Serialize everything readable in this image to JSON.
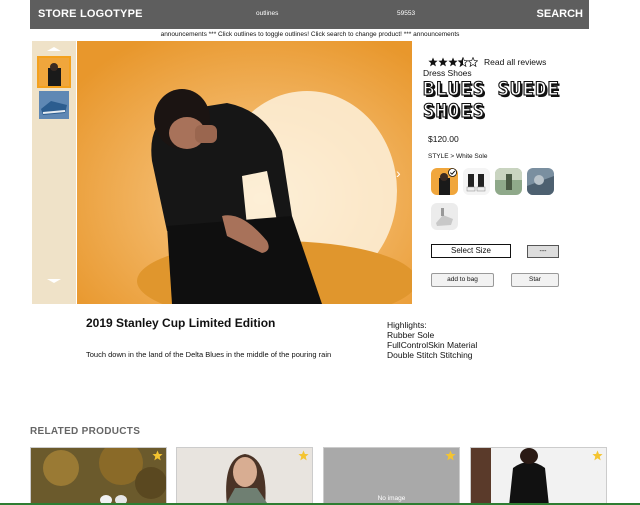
{
  "header": {
    "logo": "STORE LOGOTYPE",
    "center_text": "outlines",
    "code": "59553",
    "search_label": "SEARCH"
  },
  "announcement": "announcements *** Click outlines to toggle outlines! Click search to change product! *** announcements",
  "product": {
    "rating": 3.5,
    "reviews_label": "Read all reviews",
    "category": "Dress Shoes",
    "title": "BLUES SUEDE SHOES",
    "price": "$120.00",
    "style_label": "STYLE > White Sole",
    "select_size_label": "Select Size",
    "dash_label": "---",
    "add_to_bag_label": "add to bag",
    "star_label": "Star",
    "edition": "2019 Stanley Cup Limited Edition",
    "description": "Touch down in the land of the Delta Blues in the middle of the pouring rain",
    "highlights_title": "Highlights:",
    "highlights": [
      "Rubber Sole",
      "FullControlSkin Material",
      "Double Stitch Stitching"
    ]
  },
  "related": {
    "title": "RELATED PRODUCTS",
    "no_image_label": "No image"
  },
  "colors": {
    "header_bg": "#5e5e5e",
    "accent": "#f4a11d",
    "gallery_bg": "#efe2c8"
  }
}
